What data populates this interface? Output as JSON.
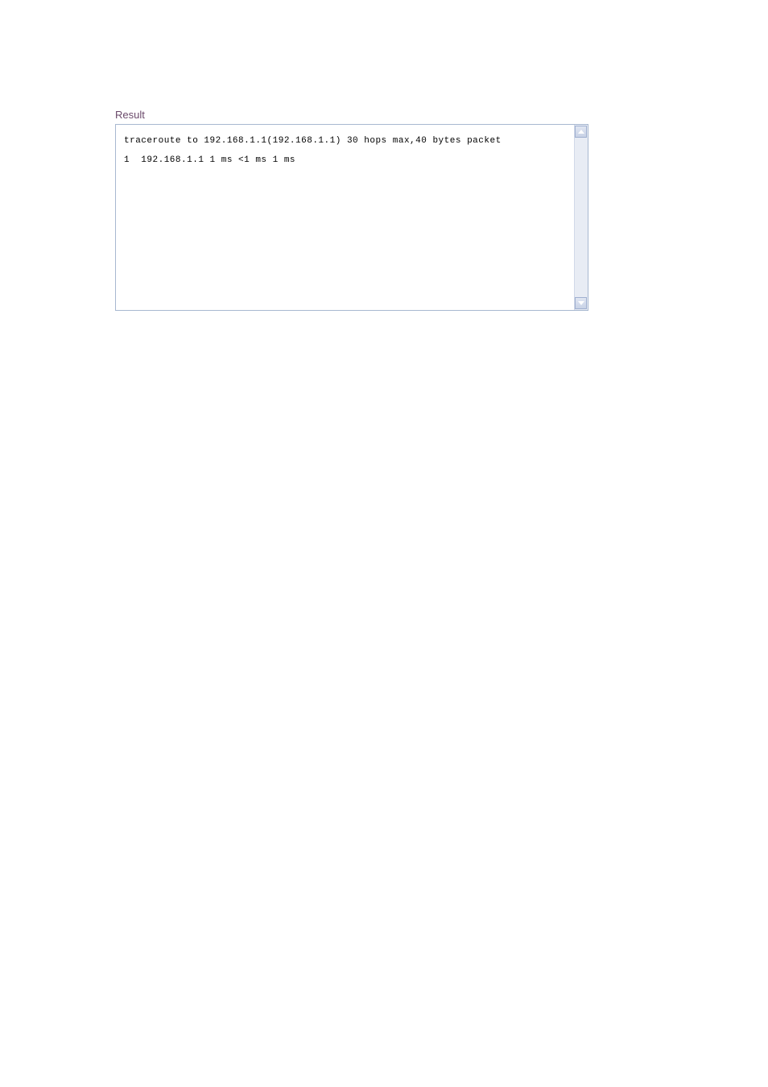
{
  "result": {
    "label": "Result",
    "lines": [
      "traceroute to 192.168.1.1(192.168.1.1) 30 hops max,40 bytes packet",
      "",
      "1  192.168.1.1 1 ms <1 ms 1 ms"
    ]
  }
}
